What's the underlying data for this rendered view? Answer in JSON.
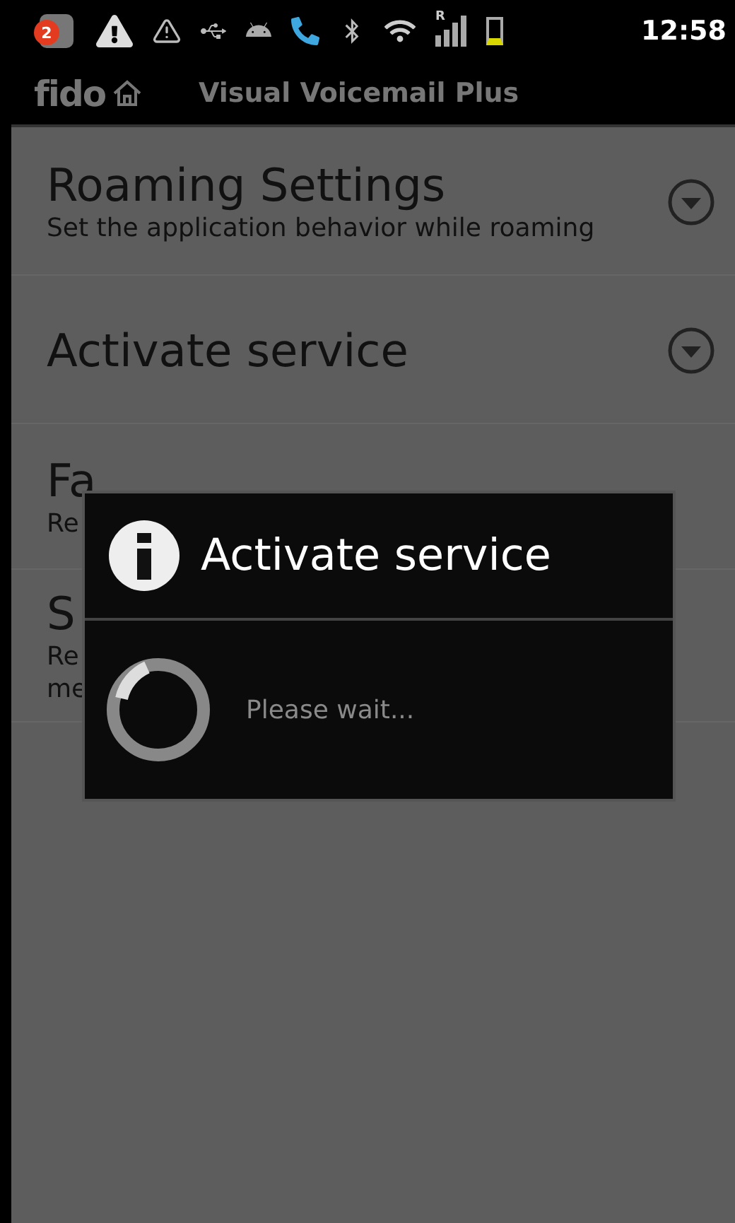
{
  "status_bar": {
    "notification_count": "2",
    "signal_roaming": "R",
    "time": "12:58"
  },
  "title_bar": {
    "logo": "fido",
    "title": "Visual Voicemail Plus"
  },
  "preferences": [
    {
      "kind": "dropdown",
      "title": "Roaming Settings",
      "summary": "Set the application behavior while roaming"
    },
    {
      "kind": "dropdown",
      "title": "Activate service"
    },
    {
      "kind": "covered",
      "title": "Fa",
      "summary": "Re"
    },
    {
      "kind": "covered",
      "title": "S",
      "summary": "Re\nme"
    }
  ],
  "dialog": {
    "title": "Activate service",
    "message": "Please wait..."
  }
}
